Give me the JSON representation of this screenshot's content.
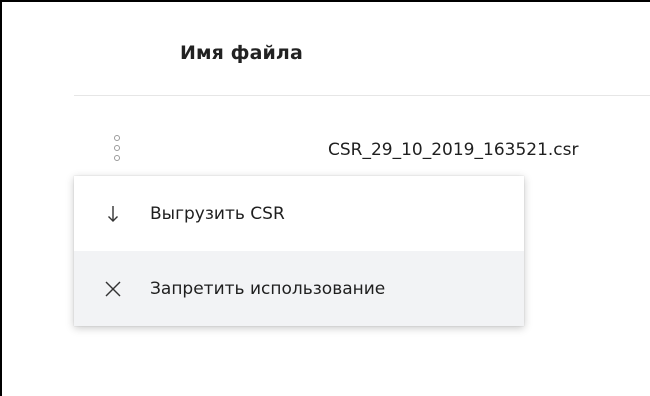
{
  "table": {
    "header_filename": "Имя файла",
    "rows": [
      {
        "filename": "CSR_29_10_2019_163521.csr"
      }
    ]
  },
  "row_actions_icon": "kebab-vertical-icon",
  "context_menu": {
    "items": [
      {
        "label": "Выгрузить CSR",
        "icon": "arrow-down-icon"
      },
      {
        "label": "Запретить использование",
        "icon": "close-icon"
      }
    ]
  },
  "colors": {
    "menu_hover_bg": "#f2f3f5",
    "text": "#1f1f1f",
    "divider": "#e6e6e6"
  }
}
